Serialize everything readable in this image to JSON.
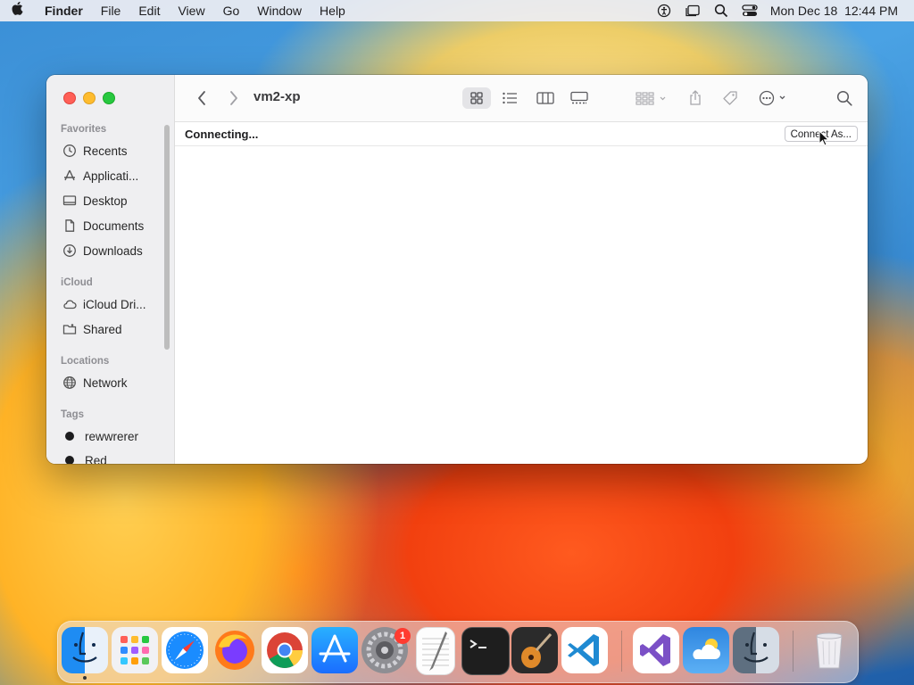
{
  "menubar": {
    "apple_icon": "apple-logo",
    "items": [
      "Finder",
      "File",
      "Edit",
      "View",
      "Go",
      "Window",
      "Help"
    ],
    "status_icons": [
      "accessibility-icon",
      "stage-manager-icon",
      "spotlight-icon",
      "control-center-icon"
    ],
    "clock": "Mon Dec 18  12:44 PM"
  },
  "window": {
    "title": "vm2-xp",
    "status_text": "Connecting...",
    "connect_as_label": "Connect As...",
    "toolbar_icons": [
      "back-icon",
      "forward-icon",
      "icon-view-icon",
      "list-view-icon",
      "column-view-icon",
      "gallery-view-icon",
      "group-icon",
      "share-icon",
      "tag-icon",
      "more-icon",
      "search-icon"
    ]
  },
  "sidebar": {
    "favorites_header": "Favorites",
    "favorites": [
      {
        "label": "Recents",
        "icon": "clock-icon"
      },
      {
        "label": "Applicati...",
        "icon": "applications-icon"
      },
      {
        "label": "Desktop",
        "icon": "desktop-icon"
      },
      {
        "label": "Documents",
        "icon": "document-icon"
      },
      {
        "label": "Downloads",
        "icon": "download-icon"
      }
    ],
    "icloud_header": "iCloud",
    "icloud": [
      {
        "label": "iCloud Dri...",
        "icon": "cloud-icon"
      },
      {
        "label": "Shared",
        "icon": "shared-folder-icon"
      }
    ],
    "locations_header": "Locations",
    "locations": [
      {
        "label": "Network",
        "icon": "network-icon"
      }
    ],
    "tags_header": "Tags",
    "tags": [
      {
        "label": "rewwrerer",
        "color": "#1c1c1e"
      },
      {
        "label": "Red",
        "color": "#1c1c1e"
      }
    ]
  },
  "dock": {
    "apps": [
      "Finder",
      "Launchpad",
      "Safari",
      "Firefox",
      "Chrome",
      "App Store",
      "System Settings",
      "TextEdit",
      "Terminal",
      "GarageBand",
      "VS Code",
      "Visual Studio",
      "Weather",
      "Finder 2",
      "Trash"
    ],
    "settings_badge": "1"
  }
}
